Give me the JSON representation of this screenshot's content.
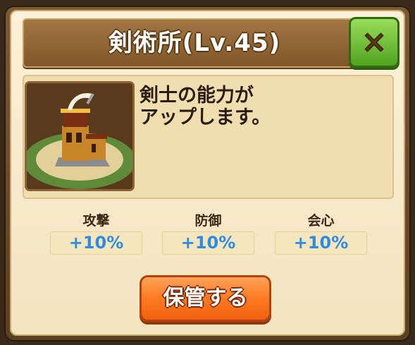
{
  "dialog": {
    "title": "剣術所(Lv.45)",
    "close_icon": "close-x-icon",
    "building_image": "sword-dojo-building",
    "description_lines": [
      "剣士の能力が",
      "アップします。"
    ]
  },
  "stats": [
    {
      "label": "攻撃",
      "value": "+10%"
    },
    {
      "label": "防御",
      "value": "+10%"
    },
    {
      "label": "会心",
      "value": "+10%"
    }
  ],
  "actions": {
    "store_label": "保管する"
  },
  "colors": {
    "close_button": "#5fb52a",
    "store_button": "#ff7a22",
    "stat_value": "#2e8be0",
    "title_bar": "#93693a"
  }
}
